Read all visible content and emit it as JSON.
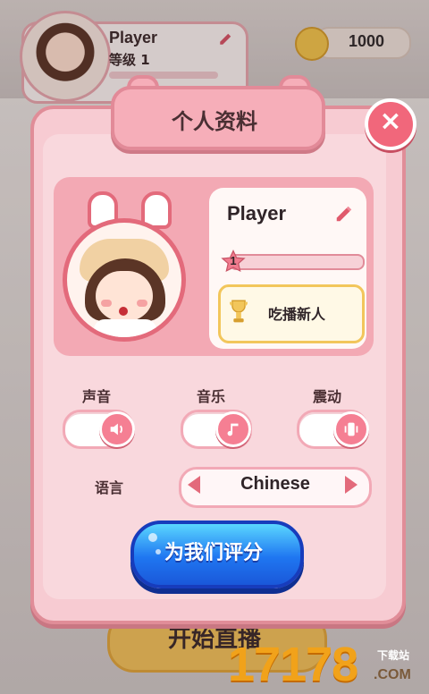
{
  "hud": {
    "player_name": "Player",
    "level_text": "等级 1",
    "coins": "1000"
  },
  "modal": {
    "title": "个人资料",
    "close_label": "×",
    "profile": {
      "name": "Player",
      "level": "1",
      "badge_text": "吃播新人"
    },
    "settings": {
      "sound_label": "声音",
      "music_label": "音乐",
      "vibration_label": "震动",
      "language_label": "语言",
      "language_value": "Chinese"
    },
    "rate_button": "为我们评分"
  },
  "behind": {
    "start_button": "开始直播"
  },
  "watermark": {
    "brand": "17178",
    "small": "下载站",
    "domain": ".COM"
  },
  "colors": {
    "modal_bg": "#f7cbd2",
    "modal_border": "#e08d98",
    "close": "#f1677b",
    "rate_button": "#1f76f1",
    "trophy": "#f2c65b"
  }
}
